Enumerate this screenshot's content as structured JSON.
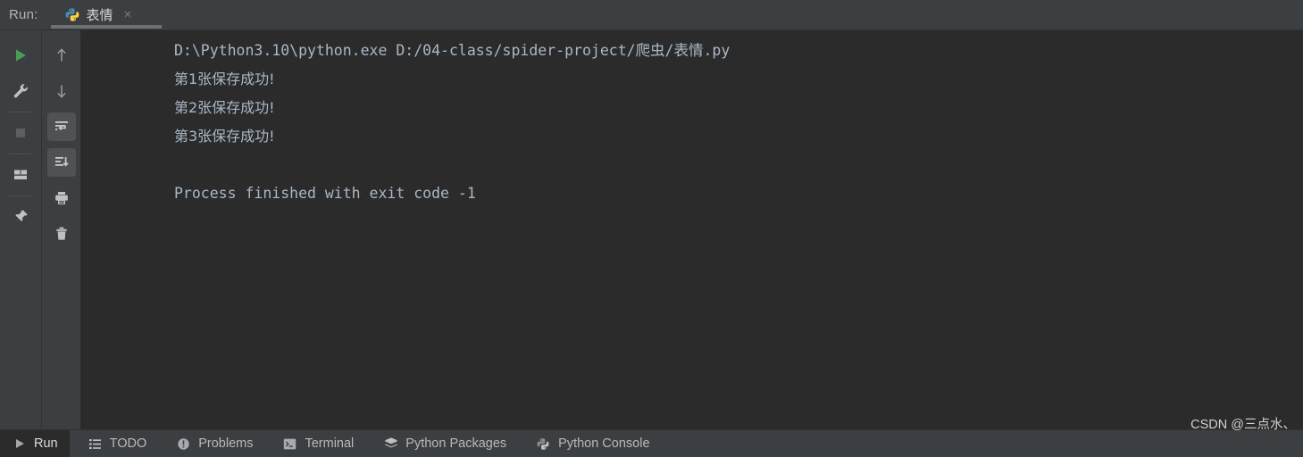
{
  "window": {
    "run_label": "Run:",
    "theme": {
      "console_bg": "#2b2b2b",
      "chrome_bg": "#3c3f41",
      "console_text": "#a9b7c6",
      "accent_green": "#499c54",
      "selected_bg": "#4e5254"
    }
  },
  "tabs": [
    {
      "icon": "python-icon",
      "label": "表情",
      "close": "×",
      "active": true
    }
  ],
  "left_toolbar": {
    "items": [
      {
        "name": "rerun-button",
        "icon": "play-icon",
        "tooltip": "Rerun"
      },
      {
        "name": "modify-run-configuration-button",
        "icon": "wrench-icon",
        "tooltip": "Modify Run Configuration"
      },
      {
        "name": "stop-button",
        "icon": "stop-icon",
        "tooltip": "Stop"
      },
      {
        "name": "layout-settings-button",
        "icon": "layout-icon",
        "tooltip": "Layout Settings"
      },
      {
        "name": "pin-tab-button",
        "icon": "pin-icon",
        "tooltip": "Pin Tab"
      }
    ]
  },
  "right_toolbar": {
    "items": [
      {
        "name": "up-the-stack-trace-button",
        "icon": "arrow-up-icon",
        "tooltip": "Up the Stack Trace"
      },
      {
        "name": "down-the-stack-trace-button",
        "icon": "arrow-down-icon",
        "tooltip": "Down the Stack Trace"
      },
      {
        "name": "soft-wrap-button",
        "icon": "soft-wrap-icon",
        "tooltip": "Soft-Wrap",
        "selected": true
      },
      {
        "name": "scroll-to-end-button",
        "icon": "scroll-to-end-icon",
        "tooltip": "Scroll to the end",
        "selected": true
      },
      {
        "name": "print-button",
        "icon": "printer-icon",
        "tooltip": "Print"
      },
      {
        "name": "clear-all-button",
        "icon": "trash-icon",
        "tooltip": "Clear All"
      }
    ]
  },
  "console": {
    "lines": [
      {
        "text": "D:\\Python3.10\\python.exe D:/04-class/spider-project/爬虫/表情.py",
        "kind": "mono"
      },
      {
        "text": "第1张保存成功!",
        "kind": "cjk"
      },
      {
        "text": "第2张保存成功!",
        "kind": "cjk"
      },
      {
        "text": "第3张保存成功!",
        "kind": "cjk"
      },
      {
        "text": " ",
        "kind": "blank"
      },
      {
        "text": "Process finished with exit code -1",
        "kind": "mono"
      }
    ]
  },
  "status_bar": {
    "items": [
      {
        "name": "status-run",
        "icon": "play-icon",
        "label": "Run",
        "active": true
      },
      {
        "name": "status-todo",
        "icon": "list-icon",
        "label": "TODO",
        "active": false
      },
      {
        "name": "status-problems",
        "icon": "warning-icon",
        "label": "Problems",
        "active": false
      },
      {
        "name": "status-terminal",
        "icon": "terminal-icon",
        "label": "Terminal",
        "active": false
      },
      {
        "name": "status-python-packages",
        "icon": "layers-icon",
        "label": "Python Packages",
        "active": false
      },
      {
        "name": "status-python-console",
        "icon": "python-icon",
        "label": "Python Console",
        "active": false
      }
    ],
    "watermark": "CSDN @三点水、"
  }
}
